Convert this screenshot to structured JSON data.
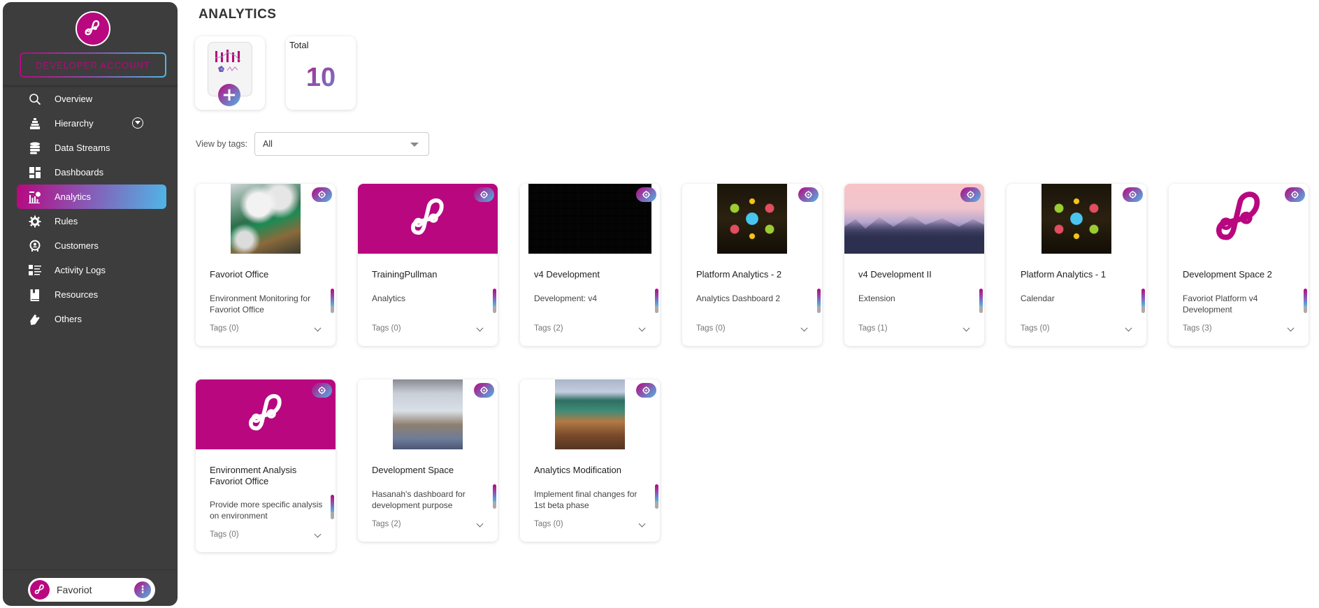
{
  "sidebar": {
    "account_label": "DEVELOPER ACCOUNT",
    "items": [
      {
        "label": "Overview",
        "icon": "search-icon",
        "active": false
      },
      {
        "label": "Hierarchy",
        "icon": "hierarchy-icon",
        "active": false,
        "expandable": true
      },
      {
        "label": "Data Streams",
        "icon": "database-icon",
        "active": false
      },
      {
        "label": "Dashboards",
        "icon": "dashboard-icon",
        "active": false
      },
      {
        "label": "Analytics",
        "icon": "analytics-icon",
        "active": true
      },
      {
        "label": "Rules",
        "icon": "gear-icon",
        "active": false
      },
      {
        "label": "Customers",
        "icon": "customer-icon",
        "active": false
      },
      {
        "label": "Activity Logs",
        "icon": "list-icon",
        "active": false
      },
      {
        "label": "Resources",
        "icon": "book-icon",
        "active": false
      },
      {
        "label": "Others",
        "icon": "tag-icon",
        "active": false
      }
    ],
    "user": {
      "name": "Favoriot",
      "more_icon": "kebab-icon"
    }
  },
  "main": {
    "title": "ANALYTICS",
    "total_label": "Total",
    "total_value": "10",
    "filter": {
      "label": "View by tags:",
      "selected": "All"
    }
  },
  "colors": {
    "brand": "#b8077f",
    "accent_blue": "#4fb6e6",
    "sidebar_bg": "#3d3d3d"
  },
  "cards": [
    {
      "title": "Favoriot Office",
      "description": "Environment Monitoring for Favoriot Office",
      "tags": "Tags (0)",
      "image": "clouds-aerial"
    },
    {
      "title": "TrainingPullman",
      "description": "Analytics",
      "tags": "Tags (0)",
      "image": "favoriot-logo"
    },
    {
      "title": "v4 Development",
      "description": "Development: v4",
      "tags": "Tags (2)",
      "image": "charcoal-texture"
    },
    {
      "title": "Platform Analytics - 2",
      "description": "Analytics Dashboard 2",
      "tags": "Tags (0)",
      "image": "iot-platform-poster"
    },
    {
      "title": "v4 Development II",
      "description": "Extension",
      "tags": "Tags (1)",
      "image": "mountain-landscape"
    },
    {
      "title": "Platform Analytics - 1",
      "description": "Calendar",
      "tags": "Tags (0)",
      "image": "iot-platform-poster"
    },
    {
      "title": "Development Space 2",
      "description": "Favoriot Platform v4 Development",
      "tags": "Tags (3)",
      "image": "favoriot-logo-white"
    },
    {
      "title": "Environment Analysis Favoriot Office",
      "description": "Provide more specific analysis on environment",
      "tags": "Tags (0)",
      "image": "favoriot-logo"
    },
    {
      "title": "Development Space",
      "description": "Hasanah's dashboard for development purpose",
      "tags": "Tags (2)",
      "image": "lab-room"
    },
    {
      "title": "Analytics Modification",
      "description": "Implement final changes for 1st beta phase",
      "tags": "Tags (0)",
      "image": "classroom"
    }
  ]
}
